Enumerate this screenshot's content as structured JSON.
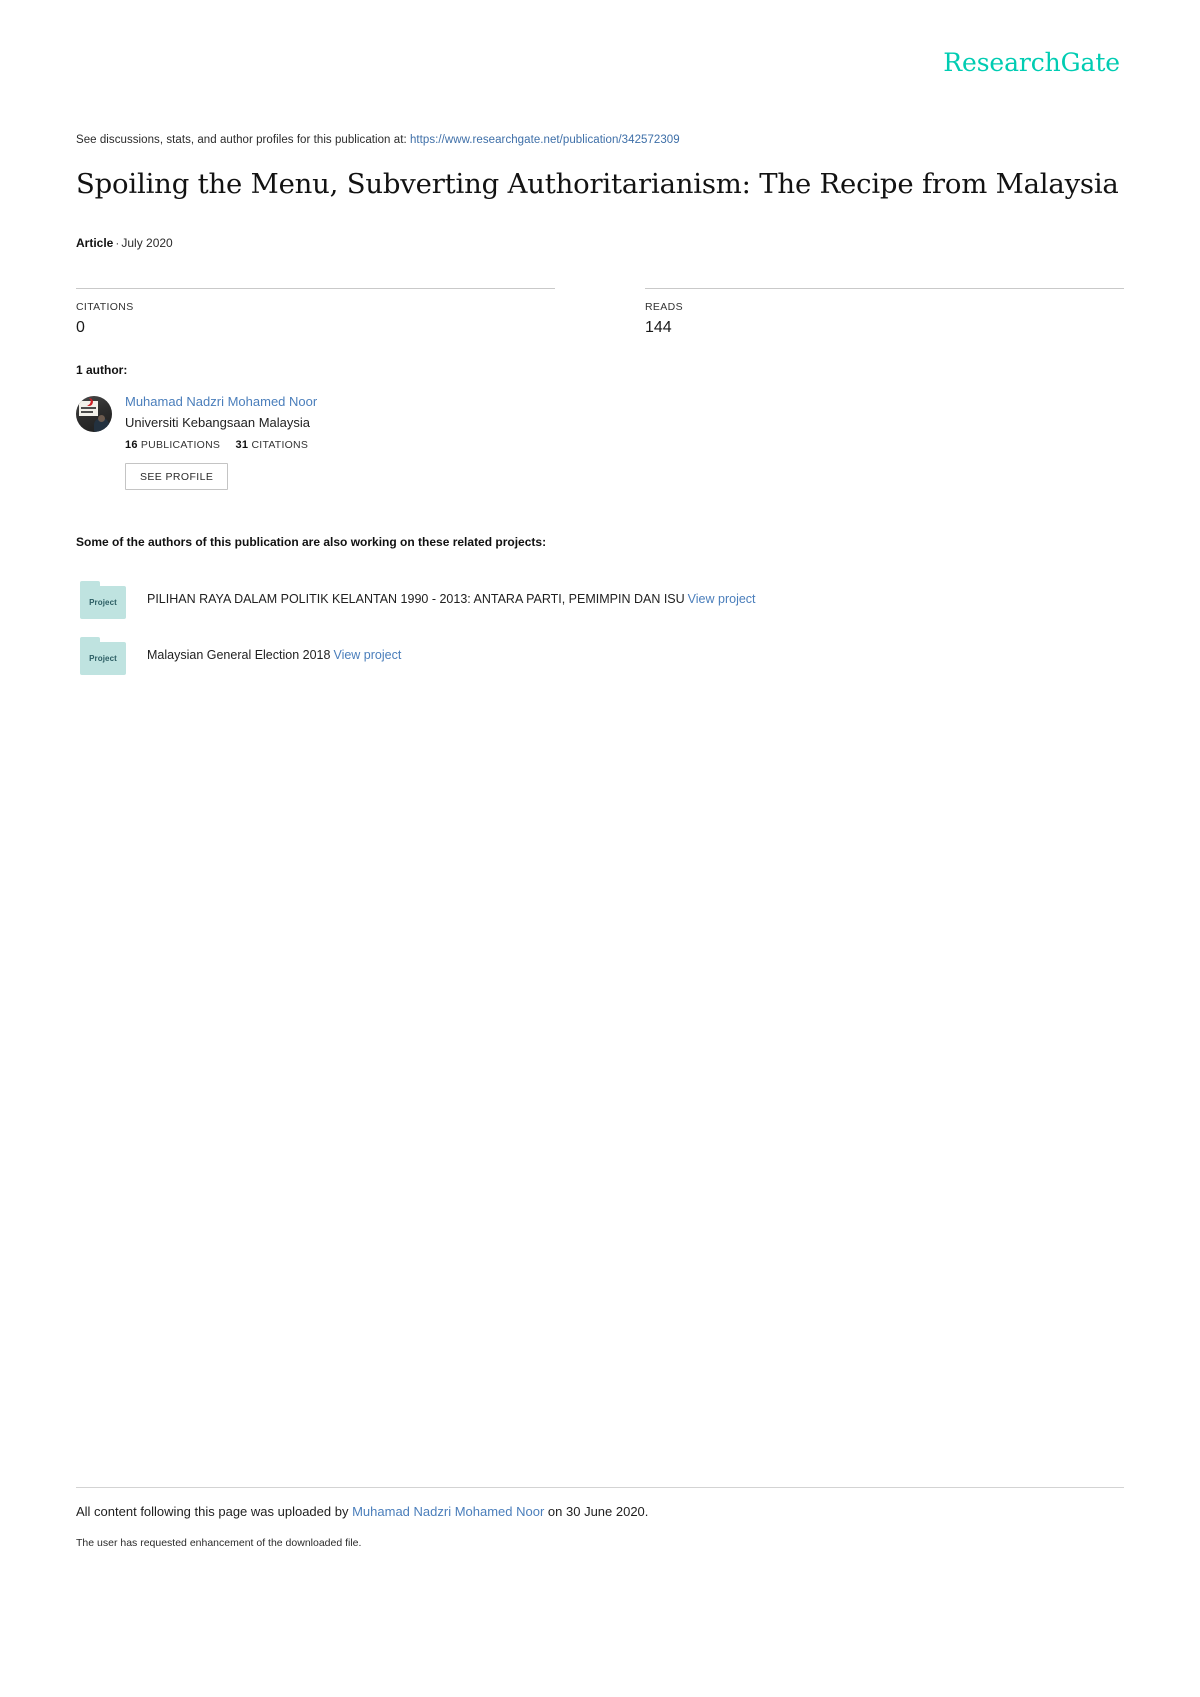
{
  "brand": {
    "logo_text": "ResearchGate",
    "accent_color": "#00ccb2",
    "link_color": "#4a7ebb"
  },
  "header": {
    "discussion_prefix": "See discussions, stats, and author profiles for this publication at:",
    "publication_url": "https://www.researchgate.net/publication/342572309"
  },
  "publication": {
    "title": "Spoiling the Menu, Subverting Authoritarianism: The Recipe from Malaysia",
    "type": "Article",
    "separator": "·",
    "date": "July 2020"
  },
  "stats": [
    {
      "label": "CITATIONS",
      "value": "0"
    },
    {
      "label": "READS",
      "value": "144"
    }
  ],
  "authors_section": {
    "heading": "1 author:",
    "author": {
      "name": "Muhamad Nadzri Mohamed Noor",
      "affiliation": "Universiti Kebangsaan Malaysia",
      "publications_count": "16",
      "publications_label": "PUBLICATIONS",
      "citations_count": "31",
      "citations_label": "CITATIONS",
      "profile_button": "SEE PROFILE"
    }
  },
  "projects_section": {
    "heading": "Some of the authors of this publication are also working on these related projects:",
    "folder_label": "Project",
    "items": [
      {
        "title": "PILIHAN RAYA DALAM POLITIK KELANTAN 1990 - 2013: ANTARA PARTI, PEMIMPIN DAN ISU",
        "link_text": "View project"
      },
      {
        "title": "Malaysian General Election 2018",
        "link_text": "View project"
      }
    ]
  },
  "footer": {
    "upload_prefix": "All content following this page was uploaded by",
    "uploader_name": "Muhamad Nadzri Mohamed Noor",
    "upload_suffix": "on 30 June 2020.",
    "note": "The user has requested enhancement of the downloaded file."
  }
}
